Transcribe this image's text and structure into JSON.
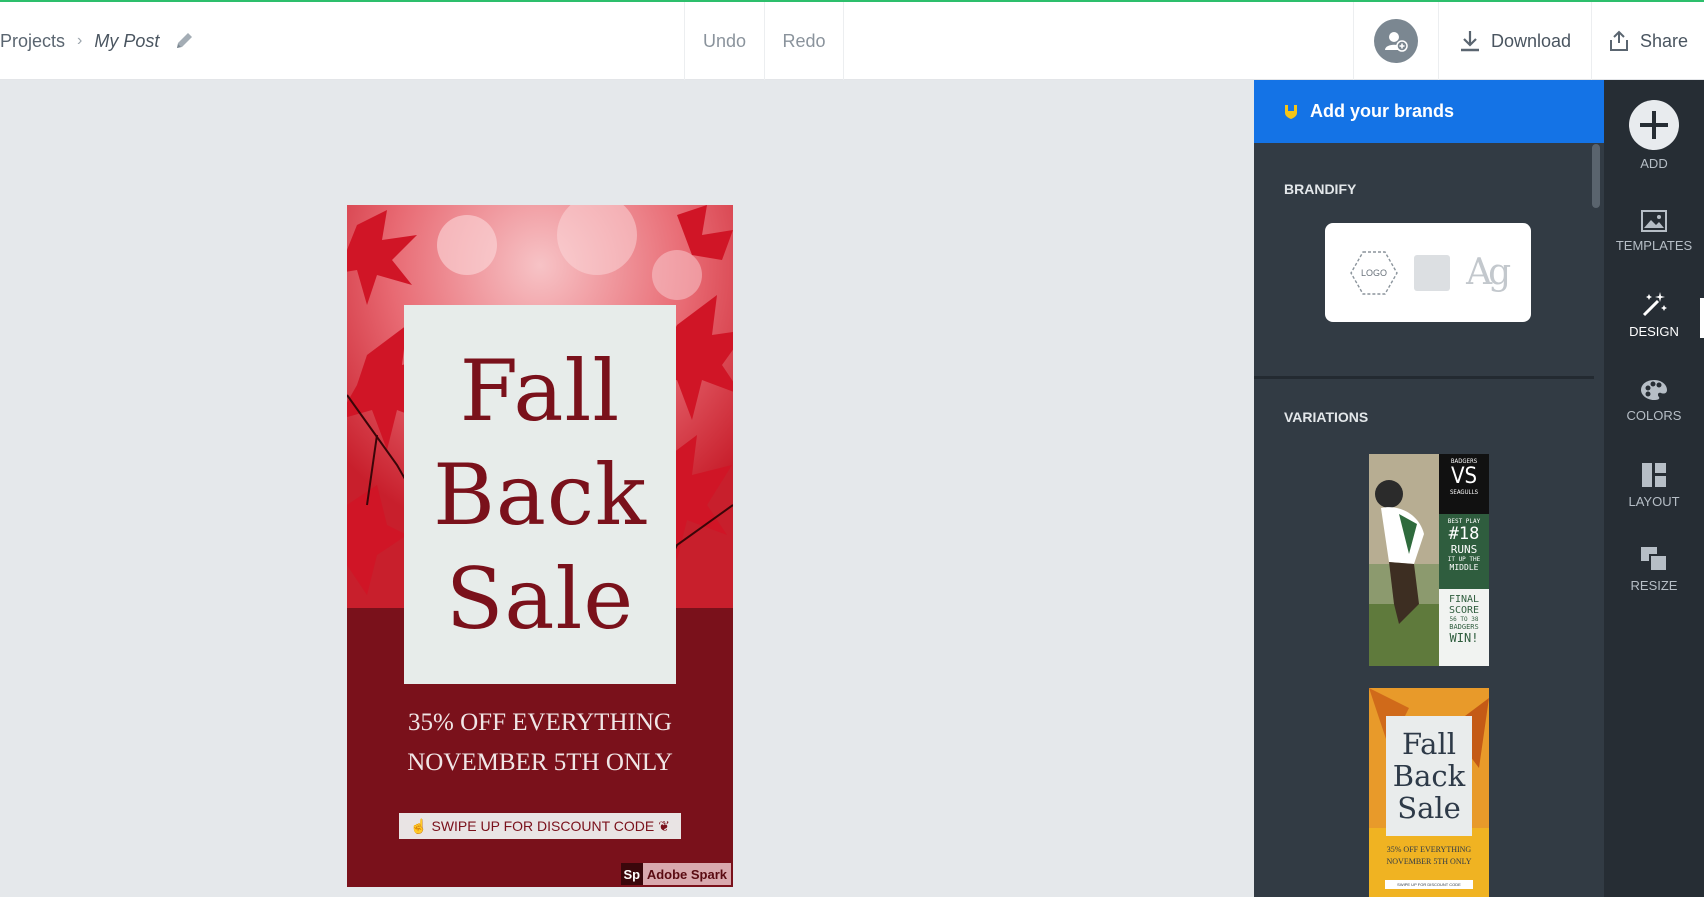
{
  "breadcrumb": {
    "projects": "Projects",
    "post": "My Post"
  },
  "history": {
    "undo": "Undo",
    "redo": "Redo"
  },
  "actions": {
    "download": "Download",
    "share": "Share"
  },
  "poster": {
    "headline": [
      "Fall",
      "Back",
      "Sale"
    ],
    "offer_line1": "35% OFF EVERYTHING",
    "offer_line2": "NOVEMBER 5TH ONLY",
    "swipe": "SWIPE UP FOR DISCOUNT CODE",
    "badge_icon": "Sp",
    "badge": "Adobe Spark"
  },
  "panel": {
    "brands_banner": "Add your brands",
    "brandify_title": "BRANDIFY",
    "logo_label": "LOGO",
    "font_glyph": "Ag",
    "variations_title": "VARIATIONS",
    "variation1": {
      "top": "BADGERS",
      "vs": "VS",
      "bottom": "SEAGULLS",
      "best": "BEST PLAY",
      "num": "#18",
      "runs": "RUNS",
      "up": "IT UP THE",
      "middle": "MIDDLE",
      "final": "FINAL",
      "score": "SCORE",
      "result": "56 TO 38",
      "team": "BADGERS",
      "win": "WIN!"
    },
    "variation2": {
      "headline": [
        "Fall",
        "Back",
        "Sale"
      ],
      "line1": "35% OFF EVERYTHING",
      "line2": "NOVEMBER 5TH ONLY",
      "swipe": "SWIPE UP FOR DISCOUNT CODE"
    }
  },
  "rail": {
    "add": "ADD",
    "templates": "TEMPLATES",
    "design": "DESIGN",
    "colors": "COLORS",
    "layout": "LAYOUT",
    "resize": "RESIZE",
    "active": "design"
  },
  "colors": {
    "accent": "#1473e6",
    "poster_red": "#7a111b",
    "progress": "#2dbf6c"
  }
}
